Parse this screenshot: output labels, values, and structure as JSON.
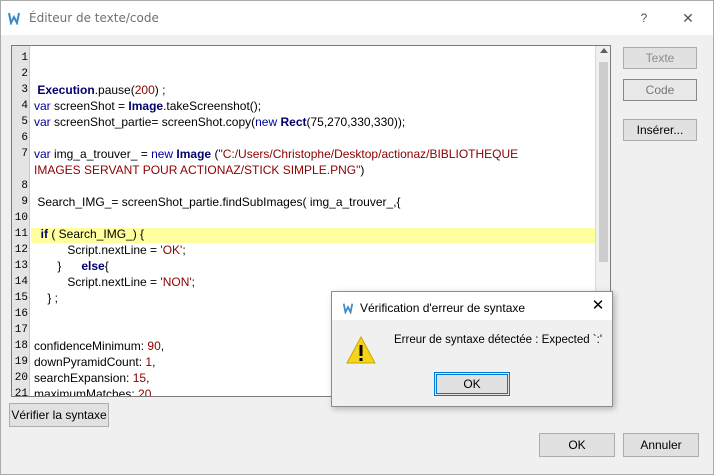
{
  "window": {
    "title": "Éditeur de texte/code",
    "help_label": "?",
    "close_label": "✕"
  },
  "editor": {
    "line_numbers": [
      "1",
      "2",
      "3",
      "4",
      "5",
      "6",
      "7",
      "",
      "8",
      "9",
      "10",
      "11",
      "12",
      "13",
      "14",
      "15",
      "16",
      "17",
      "18",
      "19",
      "20",
      "21"
    ],
    "lines": {
      "l3_a": " Execution",
      "l3_b": ".pause(",
      "l3_c": "200",
      "l3_d": ") ;",
      "l4_a": "var",
      "l4_b": " screenShot = ",
      "l4_c": "Image",
      "l4_d": ".takeScreenshot();",
      "l5_a": "var",
      "l5_b": " screenShot_partie= screenShot.copy(",
      "l5_c": "new",
      "l5_d": " ",
      "l5_e": "Rect",
      "l5_f": "(75,270,330,330));",
      "l7_a": "var",
      "l7_b": " img_a_trouver_ = ",
      "l7_c": "new",
      "l7_d": " ",
      "l7_e": "Image",
      "l7_f": " (",
      "l7_g": "\"C:/Users/Christophe/Desktop/actionaz/BIBLIOTHEQUE",
      "l7_h": "IMAGES SERVANT POUR ACTIONAZ/STICK SIMPLE.PNG\"",
      "l7_i": ")",
      "l9": " Search_IMG_= screenShot_partie.findSubImages( img_a_trouver_,{",
      "l11_a": "  ",
      "l11_b": "if",
      "l11_c": " ( Search_IMG_) {",
      "l12_a": "          Script.nextLine = ",
      "l12_b": "'OK'",
      "l12_c": ";",
      "l13_a": "       }      ",
      "l13_b": "else",
      "l13_c": "{",
      "l14_a": "          Script.nextLine = ",
      "l14_b": "'NON'",
      "l14_c": ";",
      "l15": "    } ;",
      "l18_a": "confidenceMinimum: ",
      "l18_b": "90",
      "l18_c": ",",
      "l19_a": "downPyramidCount: ",
      "l19_b": "1",
      "l19_c": ",",
      "l20_a": "searchExpansion: ",
      "l20_b": "15",
      "l20_c": ",",
      "l21_a": "maximumMatches: ",
      "l21_b": "20"
    }
  },
  "side_buttons": {
    "texte": "Texte",
    "code": "Code",
    "inserer": "Insérer..."
  },
  "bottom": {
    "verify": "Vérifier la syntaxe",
    "ok": "OK",
    "cancel": "Annuler"
  },
  "dialog": {
    "title": "Vérification d'erreur de syntaxe",
    "close": "✕",
    "message": "Erreur de syntaxe détectée : Expected `:'",
    "ok": "OK"
  },
  "colors": {
    "highlight": "#ffffa0",
    "keyword": "#00006e",
    "string": "#8b0000"
  }
}
